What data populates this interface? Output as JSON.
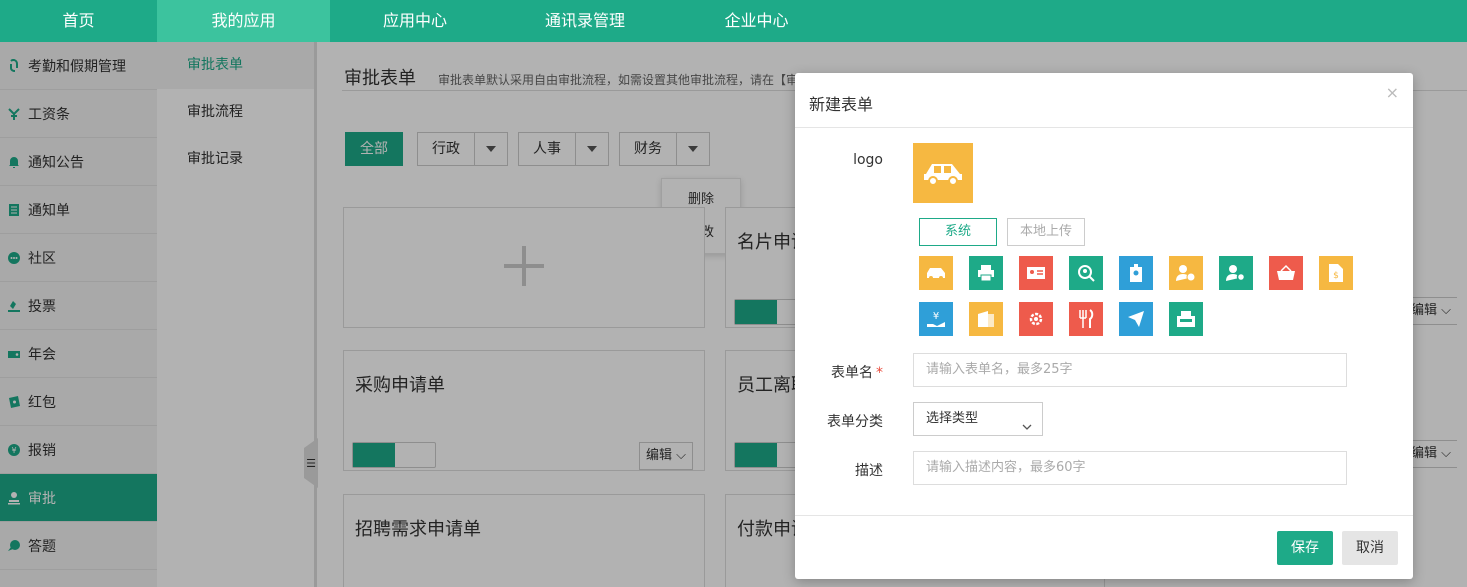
{
  "topnav": [
    {
      "label": "首页"
    },
    {
      "label": "我的应用"
    },
    {
      "label": "应用中心"
    },
    {
      "label": "通讯录管理"
    },
    {
      "label": "企业中心"
    }
  ],
  "sidebar": [
    {
      "label": "考勤和假期管理",
      "icon": "fingerprint-icon"
    },
    {
      "label": "工资条",
      "icon": "yuan-sprout-icon"
    },
    {
      "label": "通知公告",
      "icon": "bell-icon"
    },
    {
      "label": "通知单",
      "icon": "document-icon"
    },
    {
      "label": "社区",
      "icon": "chat-bubble-icon"
    },
    {
      "label": "投票",
      "icon": "vote-icon"
    },
    {
      "label": "年会",
      "icon": "ticket-icon"
    },
    {
      "label": "红包",
      "icon": "red-envelope-icon"
    },
    {
      "label": "报销",
      "icon": "yuan-circle-icon"
    },
    {
      "label": "审批",
      "icon": "person-icon"
    },
    {
      "label": "答题",
      "icon": "quiz-icon"
    }
  ],
  "subside": [
    {
      "label": "审批表单"
    },
    {
      "label": "审批流程"
    },
    {
      "label": "审批记录"
    }
  ],
  "main": {
    "title": "审批表单",
    "desc": "审批表单默认采用自由审批流程，如需设置其他审批流程，请在【审",
    "filter_all": "全部",
    "filters": [
      "行政",
      "人事",
      "财务"
    ],
    "menu": [
      "删除",
      "修改"
    ],
    "cards": {
      "c1": "名片申请",
      "c2": "采购申请单",
      "c3": "员工离职",
      "c4": "招聘需求申请单",
      "c5": "付款申请"
    },
    "edit_label": "编辑 ⌵",
    "edit_label_short": "编辑 ⌵"
  },
  "modal": {
    "title": "新建表单",
    "close": "×",
    "logo_label": "logo",
    "src_system": "系统",
    "src_local": "本地上传",
    "icons": [
      {
        "name": "car-icon",
        "color": "#f6b841"
      },
      {
        "name": "printer-icon",
        "color": "#1eaa88"
      },
      {
        "name": "id-card-icon",
        "color": "#ee5b4c"
      },
      {
        "name": "search-person-icon",
        "color": "#1eaa88"
      },
      {
        "name": "badge-icon",
        "color": "#2f9fd8"
      },
      {
        "name": "user-money-icon",
        "color": "#f6b841"
      },
      {
        "name": "user-gear-icon",
        "color": "#1eaa88"
      },
      {
        "name": "basket-icon",
        "color": "#ee5b4c"
      },
      {
        "name": "document-money-icon",
        "color": "#f6b841"
      },
      {
        "name": "hand-yuan-icon",
        "color": "#2f9fd8"
      },
      {
        "name": "folder-icon",
        "color": "#f6b841"
      },
      {
        "name": "gear-icon",
        "color": "#ee5b4c"
      },
      {
        "name": "fork-knife-icon",
        "color": "#ee5b4c"
      },
      {
        "name": "airplane-icon",
        "color": "#2f9fd8"
      },
      {
        "name": "cash-register-icon",
        "color": "#1eaa88"
      }
    ],
    "name_label": "表单名",
    "name_placeholder": "请输入表单名，最多25字",
    "category_label": "表单分类",
    "category_value": "选择类型",
    "desc_label": "描述",
    "desc_placeholder": "请输入描述内容，最多60字",
    "save": "保存",
    "cancel": "取消"
  }
}
